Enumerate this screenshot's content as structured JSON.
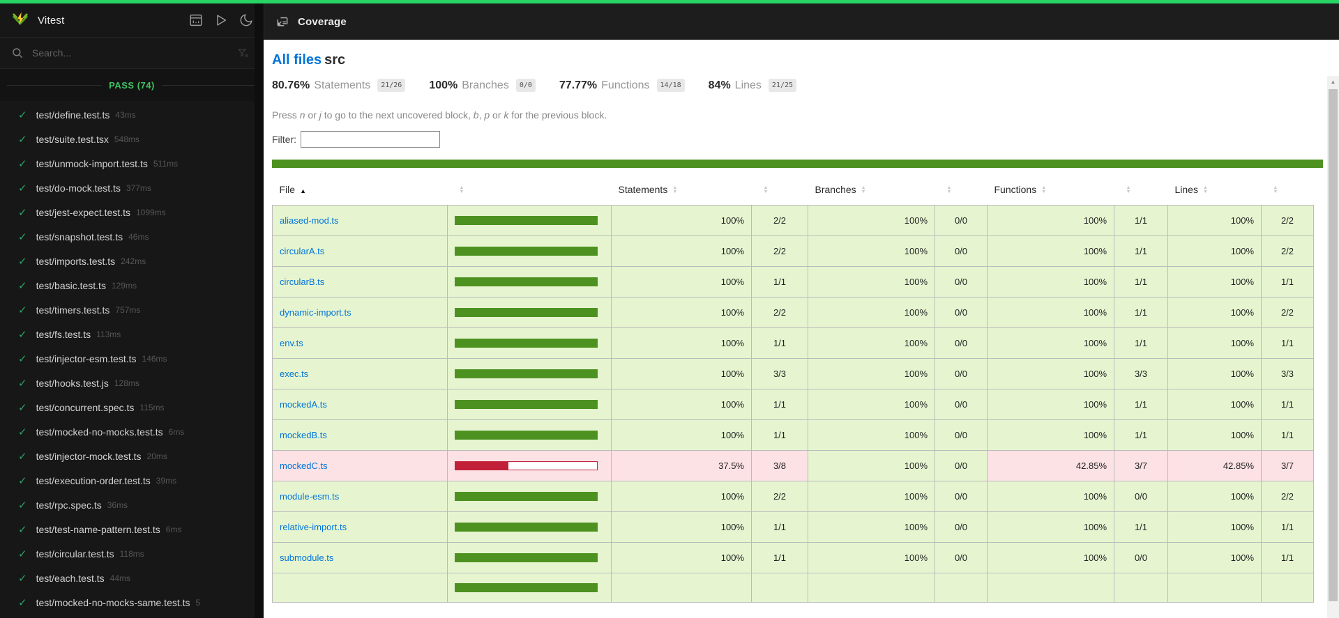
{
  "app": {
    "title": "Vitest",
    "nav_title": "Coverage"
  },
  "colors": {
    "top_strip_green": "#28d464",
    "pass_green": "#41c363",
    "check_green": "#2fa266",
    "link_blue": "#0074D9",
    "bar_green": "#4D9221",
    "bar_red": "#C21F39",
    "row_high_bg": "#E6F5D0",
    "row_low_bg": "#FCE1E5"
  },
  "sidebar": {
    "search_placeholder": "Search...",
    "section_label": "PASS (74)",
    "items": [
      {
        "name": "test/define.test.ts",
        "duration": "43ms"
      },
      {
        "name": "test/suite.test.tsx",
        "duration": "548ms"
      },
      {
        "name": "test/unmock-import.test.ts",
        "duration": "511ms"
      },
      {
        "name": "test/do-mock.test.ts",
        "duration": "377ms"
      },
      {
        "name": "test/jest-expect.test.ts",
        "duration": "1099ms"
      },
      {
        "name": "test/snapshot.test.ts",
        "duration": "46ms"
      },
      {
        "name": "test/imports.test.ts",
        "duration": "242ms"
      },
      {
        "name": "test/basic.test.ts",
        "duration": "129ms"
      },
      {
        "name": "test/timers.test.ts",
        "duration": "757ms"
      },
      {
        "name": "test/fs.test.ts",
        "duration": "113ms"
      },
      {
        "name": "test/injector-esm.test.ts",
        "duration": "146ms"
      },
      {
        "name": "test/hooks.test.js",
        "duration": "128ms"
      },
      {
        "name": "test/concurrent.spec.ts",
        "duration": "115ms"
      },
      {
        "name": "test/mocked-no-mocks.test.ts",
        "duration": "6ms"
      },
      {
        "name": "test/injector-mock.test.ts",
        "duration": "20ms"
      },
      {
        "name": "test/execution-order.test.ts",
        "duration": "39ms"
      },
      {
        "name": "test/rpc.spec.ts",
        "duration": "36ms"
      },
      {
        "name": "test/test-name-pattern.test.ts",
        "duration": "6ms"
      },
      {
        "name": "test/circular.test.ts",
        "duration": "118ms"
      },
      {
        "name": "test/each.test.ts",
        "duration": "44ms"
      },
      {
        "name": "test/mocked-no-mocks-same.test.ts",
        "duration": "5"
      }
    ]
  },
  "coverage": {
    "breadcrumb": {
      "link": "All files",
      "current": "src"
    },
    "stats": [
      {
        "pct": "80.76%",
        "label": "Statements",
        "frac": "21/26"
      },
      {
        "pct": "100%",
        "label": "Branches",
        "frac": "0/0"
      },
      {
        "pct": "77.77%",
        "label": "Functions",
        "frac": "14/18"
      },
      {
        "pct": "84%",
        "label": "Lines",
        "frac": "21/25"
      }
    ],
    "hint_segments": [
      {
        "text": "Press "
      },
      {
        "key": "n"
      },
      {
        "text": " or "
      },
      {
        "key": "j"
      },
      {
        "text": " to go to the next uncovered block, "
      },
      {
        "key": "b"
      },
      {
        "text": ", "
      },
      {
        "key": "p"
      },
      {
        "text": " or "
      },
      {
        "key": "k"
      },
      {
        "text": " for the previous block."
      }
    ],
    "filter_label": "Filter:",
    "table": {
      "headers": {
        "file": "File",
        "statements": "Statements",
        "branches": "Branches",
        "functions": "Functions",
        "lines": "Lines"
      },
      "rows": [
        {
          "file": "aliased-mod.ts",
          "level": "high",
          "bar_pct": 100,
          "statements": {
            "pct": "100%",
            "frac": "2/2",
            "level": "high"
          },
          "branches": {
            "pct": "100%",
            "frac": "0/0",
            "level": "high"
          },
          "functions": {
            "pct": "100%",
            "frac": "1/1",
            "level": "high"
          },
          "lines": {
            "pct": "100%",
            "frac": "2/2",
            "level": "high"
          }
        },
        {
          "file": "circularA.ts",
          "level": "high",
          "bar_pct": 100,
          "statements": {
            "pct": "100%",
            "frac": "2/2",
            "level": "high"
          },
          "branches": {
            "pct": "100%",
            "frac": "0/0",
            "level": "high"
          },
          "functions": {
            "pct": "100%",
            "frac": "1/1",
            "level": "high"
          },
          "lines": {
            "pct": "100%",
            "frac": "2/2",
            "level": "high"
          }
        },
        {
          "file": "circularB.ts",
          "level": "high",
          "bar_pct": 100,
          "statements": {
            "pct": "100%",
            "frac": "1/1",
            "level": "high"
          },
          "branches": {
            "pct": "100%",
            "frac": "0/0",
            "level": "high"
          },
          "functions": {
            "pct": "100%",
            "frac": "1/1",
            "level": "high"
          },
          "lines": {
            "pct": "100%",
            "frac": "1/1",
            "level": "high"
          }
        },
        {
          "file": "dynamic-import.ts",
          "level": "high",
          "bar_pct": 100,
          "statements": {
            "pct": "100%",
            "frac": "2/2",
            "level": "high"
          },
          "branches": {
            "pct": "100%",
            "frac": "0/0",
            "level": "high"
          },
          "functions": {
            "pct": "100%",
            "frac": "1/1",
            "level": "high"
          },
          "lines": {
            "pct": "100%",
            "frac": "2/2",
            "level": "high"
          }
        },
        {
          "file": "env.ts",
          "level": "high",
          "bar_pct": 100,
          "statements": {
            "pct": "100%",
            "frac": "1/1",
            "level": "high"
          },
          "branches": {
            "pct": "100%",
            "frac": "0/0",
            "level": "high"
          },
          "functions": {
            "pct": "100%",
            "frac": "1/1",
            "level": "high"
          },
          "lines": {
            "pct": "100%",
            "frac": "1/1",
            "level": "high"
          }
        },
        {
          "file": "exec.ts",
          "level": "high",
          "bar_pct": 100,
          "statements": {
            "pct": "100%",
            "frac": "3/3",
            "level": "high"
          },
          "branches": {
            "pct": "100%",
            "frac": "0/0",
            "level": "high"
          },
          "functions": {
            "pct": "100%",
            "frac": "3/3",
            "level": "high"
          },
          "lines": {
            "pct": "100%",
            "frac": "3/3",
            "level": "high"
          }
        },
        {
          "file": "mockedA.ts",
          "level": "high",
          "bar_pct": 100,
          "statements": {
            "pct": "100%",
            "frac": "1/1",
            "level": "high"
          },
          "branches": {
            "pct": "100%",
            "frac": "0/0",
            "level": "high"
          },
          "functions": {
            "pct": "100%",
            "frac": "1/1",
            "level": "high"
          },
          "lines": {
            "pct": "100%",
            "frac": "1/1",
            "level": "high"
          }
        },
        {
          "file": "mockedB.ts",
          "level": "high",
          "bar_pct": 100,
          "statements": {
            "pct": "100%",
            "frac": "1/1",
            "level": "high"
          },
          "branches": {
            "pct": "100%",
            "frac": "0/0",
            "level": "high"
          },
          "functions": {
            "pct": "100%",
            "frac": "1/1",
            "level": "high"
          },
          "lines": {
            "pct": "100%",
            "frac": "1/1",
            "level": "high"
          }
        },
        {
          "file": "mockedC.ts",
          "level": "low",
          "bar_pct": 37.5,
          "statements": {
            "pct": "37.5%",
            "frac": "3/8",
            "level": "low"
          },
          "branches": {
            "pct": "100%",
            "frac": "0/0",
            "level": "high"
          },
          "functions": {
            "pct": "42.85%",
            "frac": "3/7",
            "level": "low"
          },
          "lines": {
            "pct": "42.85%",
            "frac": "3/7",
            "level": "low"
          }
        },
        {
          "file": "module-esm.ts",
          "level": "high",
          "bar_pct": 100,
          "statements": {
            "pct": "100%",
            "frac": "2/2",
            "level": "high"
          },
          "branches": {
            "pct": "100%",
            "frac": "0/0",
            "level": "high"
          },
          "functions": {
            "pct": "100%",
            "frac": "0/0",
            "level": "high"
          },
          "lines": {
            "pct": "100%",
            "frac": "2/2",
            "level": "high"
          }
        },
        {
          "file": "relative-import.ts",
          "level": "high",
          "bar_pct": 100,
          "statements": {
            "pct": "100%",
            "frac": "1/1",
            "level": "high"
          },
          "branches": {
            "pct": "100%",
            "frac": "0/0",
            "level": "high"
          },
          "functions": {
            "pct": "100%",
            "frac": "1/1",
            "level": "high"
          },
          "lines": {
            "pct": "100%",
            "frac": "1/1",
            "level": "high"
          }
        },
        {
          "file": "submodule.ts",
          "level": "high",
          "bar_pct": 100,
          "statements": {
            "pct": "100%",
            "frac": "1/1",
            "level": "high"
          },
          "branches": {
            "pct": "100%",
            "frac": "0/0",
            "level": "high"
          },
          "functions": {
            "pct": "100%",
            "frac": "0/0",
            "level": "high"
          },
          "lines": {
            "pct": "100%",
            "frac": "1/1",
            "level": "high"
          }
        },
        {
          "file": "",
          "level": "high",
          "bar_pct": 100,
          "statements": {
            "pct": "",
            "frac": "",
            "level": "high"
          },
          "branches": {
            "pct": "",
            "frac": "",
            "level": "high"
          },
          "functions": {
            "pct": "",
            "frac": "",
            "level": "high"
          },
          "lines": {
            "pct": "",
            "frac": "",
            "level": "high"
          }
        }
      ]
    }
  }
}
